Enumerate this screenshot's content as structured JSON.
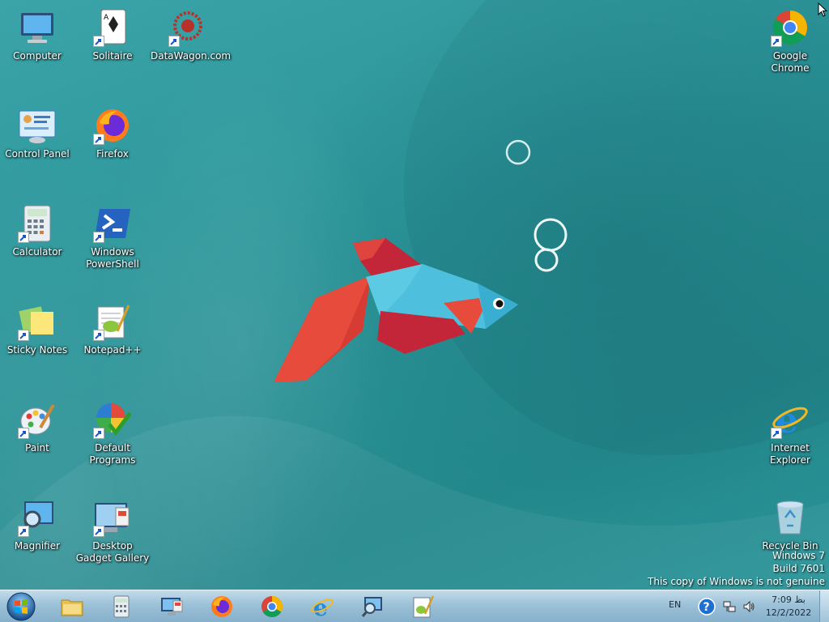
{
  "desktop": {
    "icons_left": [
      {
        "name": "icon-computer",
        "label": "Computer",
        "kind": "computer-icon"
      },
      {
        "name": "icon-solitaire",
        "label": "Solitaire",
        "kind": "solitaire-icon"
      },
      {
        "name": "icon-datawagon",
        "label": "DataWagon.com",
        "kind": "datawagon-icon"
      },
      {
        "name": "icon-control-panel",
        "label": "Control Panel",
        "kind": "control-panel-icon"
      },
      {
        "name": "icon-firefox",
        "label": "Firefox",
        "kind": "firefox-icon"
      },
      {
        "name": "icon-calculator",
        "label": "Calculator",
        "kind": "calculator-icon"
      },
      {
        "name": "icon-powershell",
        "label": "Windows PowerShell",
        "kind": "powershell-icon"
      },
      {
        "name": "icon-sticky-notes",
        "label": "Sticky Notes",
        "kind": "sticky-notes-icon"
      },
      {
        "name": "icon-notepadpp",
        "label": "Notepad++",
        "kind": "notepadpp-icon"
      },
      {
        "name": "icon-paint",
        "label": "Paint",
        "kind": "paint-icon"
      },
      {
        "name": "icon-default-programs",
        "label": "Default Programs",
        "kind": "default-programs-icon"
      },
      {
        "name": "icon-magnifier",
        "label": "Magnifier",
        "kind": "magnifier-icon"
      },
      {
        "name": "icon-gadget-gallery",
        "label": "Desktop Gadget Gallery",
        "kind": "gadget-gallery-icon"
      }
    ],
    "icons_right": [
      {
        "name": "icon-chrome",
        "label": "Google Chrome",
        "kind": "chrome-icon"
      },
      {
        "name": "icon-ie",
        "label": "Internet Explorer",
        "kind": "ie-icon"
      },
      {
        "name": "icon-recycle-bin",
        "label": "Recycle Bin",
        "kind": "recycle-bin-icon"
      }
    ],
    "watermark": {
      "line1": "Windows 7",
      "line2": "Build 7601",
      "line3": "This copy of Windows is not genuine"
    }
  },
  "taskbar": {
    "pinned": [
      {
        "name": "taskbar-explorer",
        "icon": "folder-icon"
      },
      {
        "name": "taskbar-calculator",
        "icon": "calculator-icon"
      },
      {
        "name": "taskbar-remote-desktop",
        "icon": "monitor-icon"
      },
      {
        "name": "taskbar-firefox",
        "icon": "firefox-icon"
      },
      {
        "name": "taskbar-chrome",
        "icon": "chrome-icon"
      },
      {
        "name": "taskbar-ie",
        "icon": "ie-icon"
      },
      {
        "name": "taskbar-magnifier",
        "icon": "magnifier-icon"
      },
      {
        "name": "taskbar-notepadpp",
        "icon": "notepadpp-icon"
      }
    ],
    "tray": {
      "language": "EN",
      "time": "7:09 بظ",
      "date": "12/2/2022"
    }
  },
  "colors": {
    "wallpaper": "#2b9599",
    "fish_body": "#4fc3e0",
    "fish_fin_red": "#c8283a",
    "fish_tail": "#e64b3c",
    "taskbar": "#9cc1d8"
  }
}
